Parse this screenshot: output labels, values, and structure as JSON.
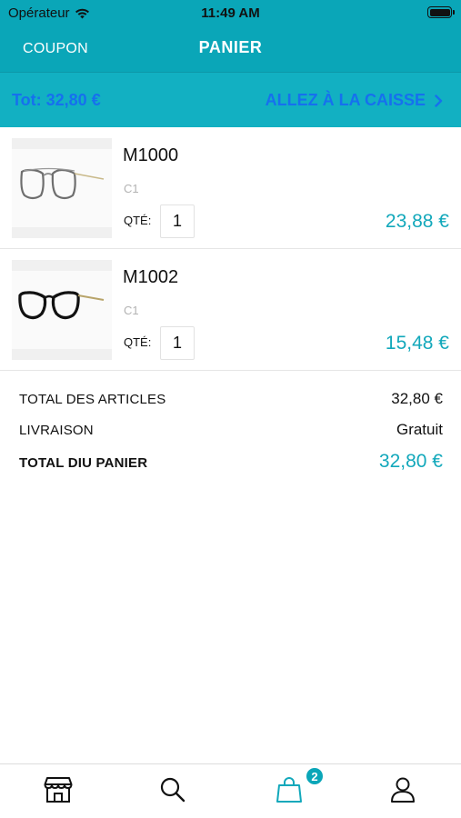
{
  "status_bar": {
    "carrier": "Opérateur",
    "time": "11:49 AM",
    "wifi_icon": "wifi-icon",
    "battery_icon": "battery-icon"
  },
  "nav": {
    "coupon_label": "COUPON",
    "title": "PANIER"
  },
  "total_bar": {
    "total_text": "Tot: 32,80 €",
    "checkout_label": "ALLEZ À LA CAISSE",
    "checkout_icon": "chevron-right-icon"
  },
  "cart": {
    "items": [
      {
        "name": "M1000",
        "variant": "C1",
        "qty_label": "QTÉ:",
        "qty": "1",
        "price": "23,88 €"
      },
      {
        "name": "M1002",
        "variant": "C1",
        "qty_label": "QTÉ:",
        "qty": "1",
        "price": "15,48 €"
      }
    ]
  },
  "summary": {
    "articles_label": "TOTAL DES ARTICLES",
    "articles_value": "32,80 €",
    "delivery_label": "LIVRAISON",
    "delivery_value": "Gratuit",
    "cart_total_label": "TOTAL DIU PANIER",
    "cart_total_value": "32,80 €"
  },
  "tab_bar": {
    "tabs": [
      {
        "icon": "store-icon"
      },
      {
        "icon": "search-icon"
      },
      {
        "icon": "shopping-bag-icon",
        "active": true
      },
      {
        "icon": "user-icon"
      }
    ],
    "cart_badge": "2"
  },
  "colors": {
    "accent": "#0aa6b8",
    "total_bar": "#12b0c2",
    "link_blue": "#1670ee",
    "price": "#12a8bb"
  }
}
